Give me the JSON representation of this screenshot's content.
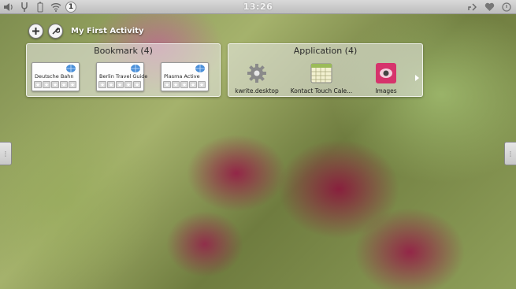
{
  "topbar": {
    "clock": "13:26",
    "notification_count": "1"
  },
  "activity": {
    "title": "My First Activity"
  },
  "bookmark_panel": {
    "title": "Bookmark (4)",
    "items": [
      {
        "label": "Deutsche Bahn",
        "rating": 0
      },
      {
        "label": "Berlin Travel Guide",
        "rating": 0
      },
      {
        "label": "Plasma Active",
        "rating": 0
      }
    ]
  },
  "application_panel": {
    "title": "Application (4)",
    "items": [
      {
        "label": "kwrite.desktop",
        "icon": "gear-icon"
      },
      {
        "label": "Kontact Touch Cale...",
        "icon": "calendar-icon"
      },
      {
        "label": "Images",
        "icon": "image-viewer-icon"
      }
    ]
  },
  "colors": {
    "topbar_bg": "#c8c8c8",
    "panel_bg": "rgba(235,235,235,0.55)",
    "image_app_icon": "#d6336c"
  }
}
